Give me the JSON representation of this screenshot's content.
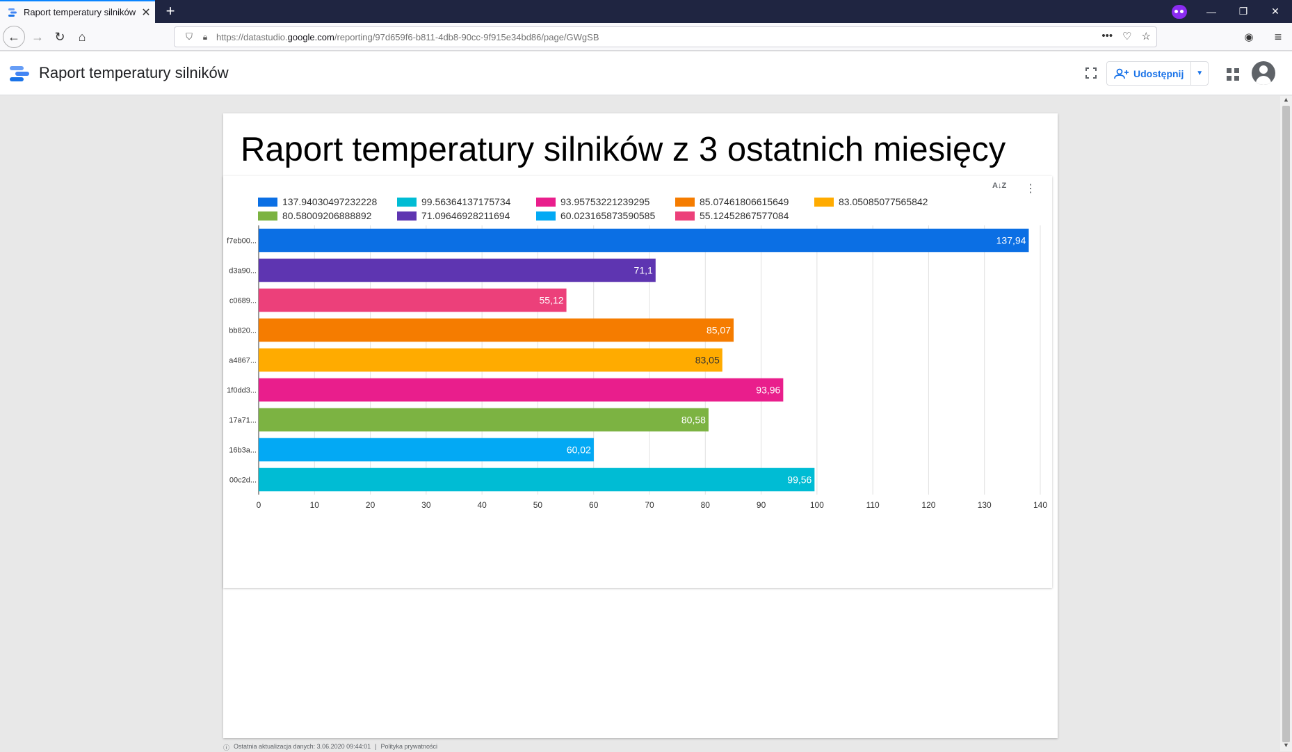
{
  "browser": {
    "tab_title": "Raport temperatury silników",
    "url_prefix": "https://datastudio.",
    "url_host": "google.com",
    "url_path": "/reporting/97d659f6-b811-4db8-90cc-9f915e34bd86/page/GWgSB"
  },
  "app": {
    "title": "Raport temperatury silników",
    "share_label": "Udostępnij"
  },
  "report": {
    "title": "Raport temperatury silników z 3 ostatnich miesięcy"
  },
  "footer": {
    "last_update": "Ostatnia aktualizacja danych: 3.06.2020 09:44:01",
    "privacy": "Polityka prywatności"
  },
  "colors": {
    "accent": "#1a73e8"
  },
  "chart_data": {
    "type": "bar",
    "orientation": "horizontal",
    "grid": true,
    "legend_position": "top",
    "xlim": [
      0,
      140
    ],
    "x_ticks": [
      0,
      10,
      20,
      30,
      40,
      50,
      60,
      70,
      80,
      90,
      100,
      110,
      120,
      130,
      140
    ],
    "categories": [
      "f7eb00...",
      "d3a90...",
      "c0689...",
      "bb820...",
      "a4867...",
      "1f0dd3...",
      "17a71...",
      "16b3a...",
      "00c2d..."
    ],
    "values": [
      137.94030497232228,
      71.09646928211694,
      55.12452867577084,
      85.07461806615649,
      83.05085077565842,
      93.95753221239295,
      80.58009206888892,
      60.023165873590585,
      99.56364137175734
    ],
    "data_labels": [
      "137,94",
      "71,1",
      "55,12",
      "85,07",
      "83,05",
      "93,96",
      "80,58",
      "60,02",
      "99,56"
    ],
    "bar_colors": [
      "#0b6fe4",
      "#5e35b1",
      "#ec407a",
      "#f57c00",
      "#ffab00",
      "#e91e8c",
      "#7cb342",
      "#03a9f4",
      "#00bcd4"
    ],
    "label_colors": [
      "#ffffff",
      "#ffffff",
      "#ffffff",
      "#ffffff",
      "#333333",
      "#ffffff",
      "#ffffff",
      "#ffffff",
      "#ffffff"
    ],
    "legend": [
      {
        "name": "137.94030497232228",
        "color": "#0b6fe4"
      },
      {
        "name": "99.56364137175734",
        "color": "#00bcd4"
      },
      {
        "name": "93.95753221239295",
        "color": "#e91e8c"
      },
      {
        "name": "85.07461806615649",
        "color": "#f57c00"
      },
      {
        "name": "83.05085077565842",
        "color": "#ffab00"
      },
      {
        "name": "80.58009206888892",
        "color": "#7cb342"
      },
      {
        "name": "71.09646928211694",
        "color": "#5e35b1"
      },
      {
        "name": "60.023165873590585",
        "color": "#03a9f4"
      },
      {
        "name": "55.12452867577084",
        "color": "#ec407a"
      }
    ]
  }
}
